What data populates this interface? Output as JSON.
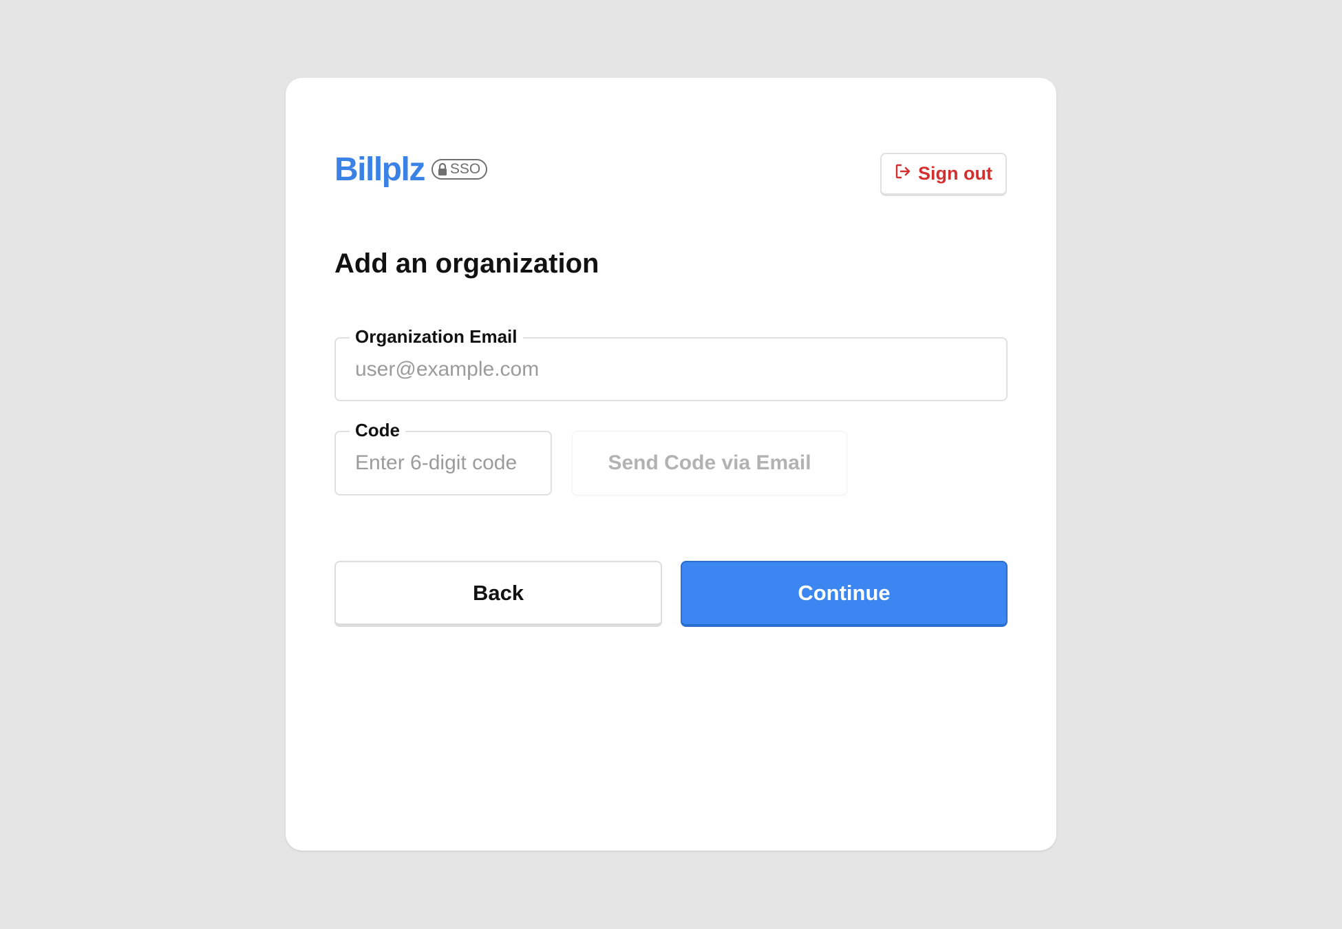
{
  "brand": {
    "name": "Billplz",
    "badge": "SSO",
    "color": "#3b82e6"
  },
  "header": {
    "signout_label": "Sign out",
    "signout_color": "#d32f2f"
  },
  "page": {
    "title": "Add an organization"
  },
  "form": {
    "email": {
      "label": "Organization Email",
      "placeholder": "user@example.com",
      "value": ""
    },
    "code": {
      "label": "Code",
      "placeholder": "Enter 6-digit code",
      "value": ""
    },
    "send_code_label": "Send Code via Email"
  },
  "actions": {
    "back_label": "Back",
    "continue_label": "Continue",
    "primary_color": "#3b86f0"
  }
}
